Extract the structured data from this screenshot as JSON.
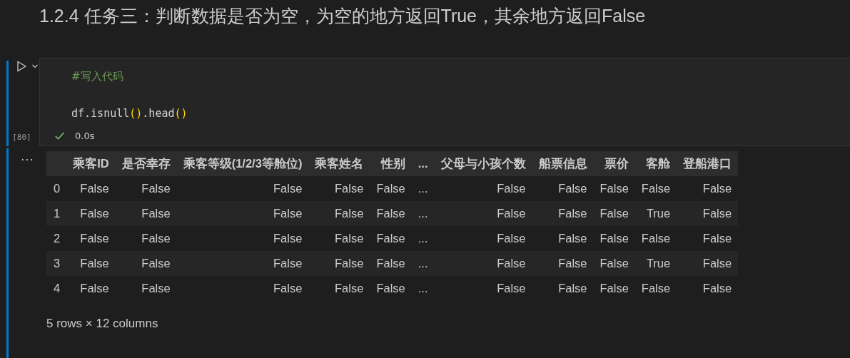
{
  "heading": "1.2.4 任务三：判断数据是否为空，为空的地方返回True，其余地方返回False",
  "cell": {
    "execution_count": "[80]",
    "succeeded": true,
    "duration": "0.0s",
    "code_lines": [
      {
        "kind": "comment",
        "tokens": [
          {
            "kind": "comment",
            "text": "#写入代码"
          }
        ]
      },
      {
        "kind": "blank"
      },
      {
        "kind": "code",
        "tokens": [
          {
            "kind": "plain",
            "text": "df.isnull"
          },
          {
            "kind": "bracket",
            "text": "()"
          },
          {
            "kind": "plain",
            "text": ".head"
          },
          {
            "kind": "bracket",
            "text": "()"
          }
        ]
      }
    ]
  },
  "output": {
    "menu": "...",
    "table": {
      "columns": [
        "乘客ID",
        "是否幸存",
        "乘客等级(1/2/3等舱位)",
        "乘客姓名",
        "性别",
        "...",
        "父母与小孩个数",
        "船票信息",
        "票价",
        "客舱",
        "登船港口"
      ],
      "rows": [
        {
          "index": "0",
          "cells": [
            "False",
            "False",
            "False",
            "False",
            "False",
            "...",
            "False",
            "False",
            "False",
            "False",
            "False"
          ]
        },
        {
          "index": "1",
          "cells": [
            "False",
            "False",
            "False",
            "False",
            "False",
            "...",
            "False",
            "False",
            "False",
            "True",
            "False"
          ]
        },
        {
          "index": "2",
          "cells": [
            "False",
            "False",
            "False",
            "False",
            "False",
            "...",
            "False",
            "False",
            "False",
            "False",
            "False"
          ]
        },
        {
          "index": "3",
          "cells": [
            "False",
            "False",
            "False",
            "False",
            "False",
            "...",
            "False",
            "False",
            "False",
            "True",
            "False"
          ]
        },
        {
          "index": "4",
          "cells": [
            "False",
            "False",
            "False",
            "False",
            "False",
            "...",
            "False",
            "False",
            "False",
            "False",
            "False"
          ]
        }
      ]
    },
    "summary": "5 rows × 12 columns"
  }
}
